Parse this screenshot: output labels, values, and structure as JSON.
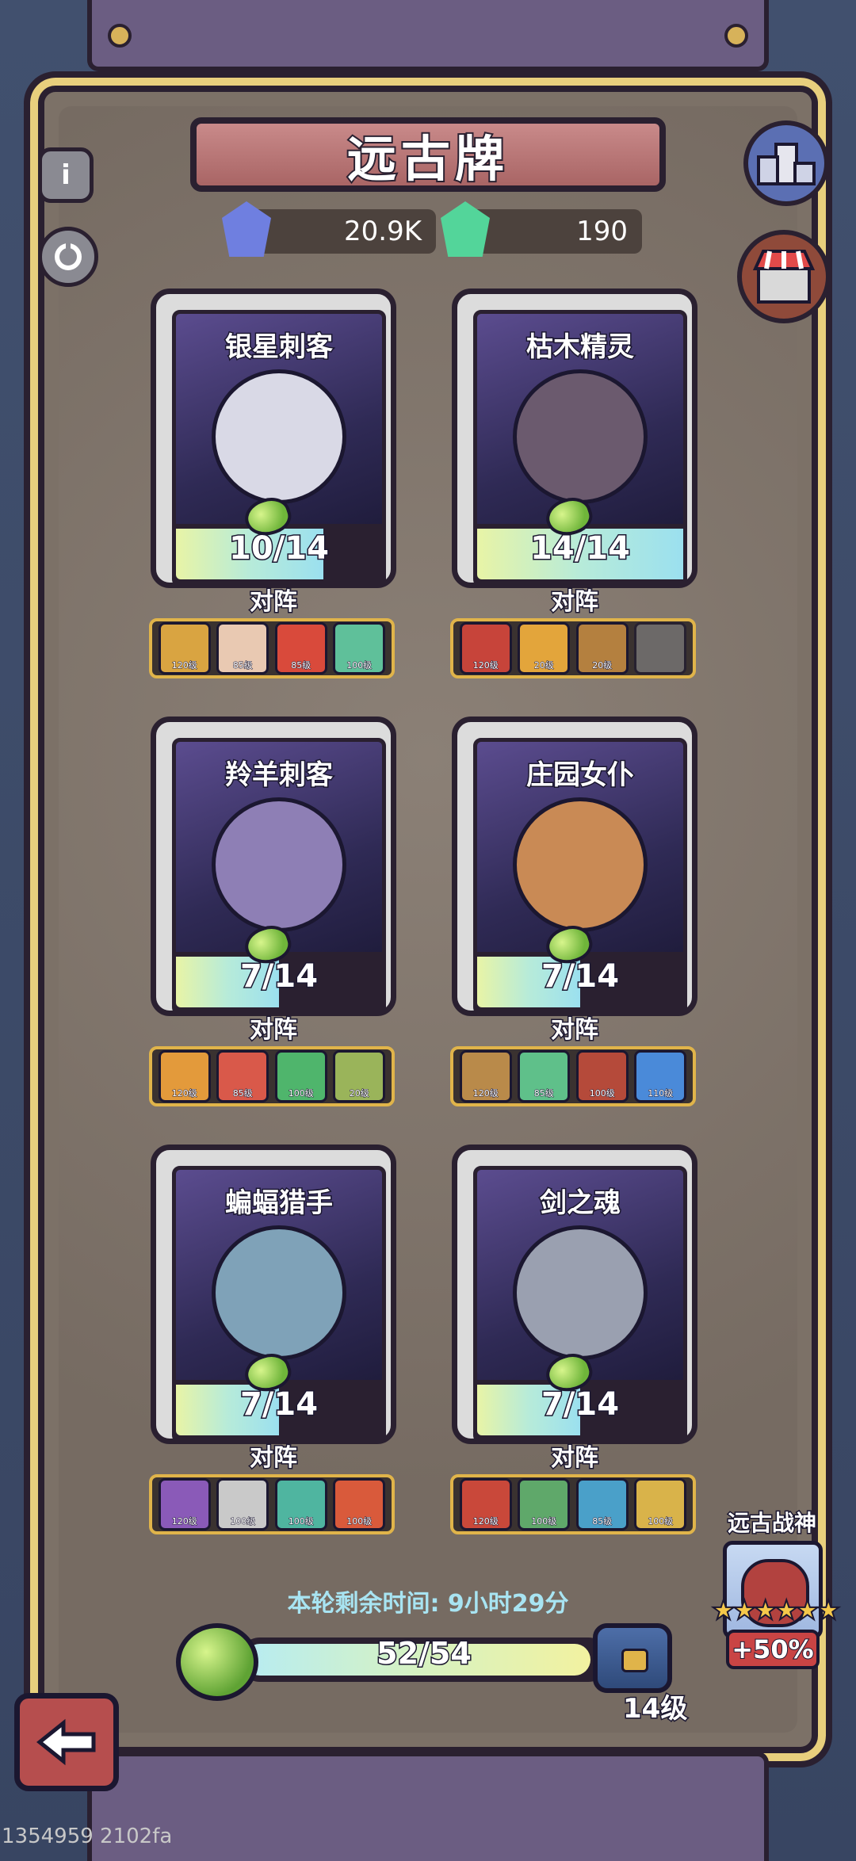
{
  "title": "远古牌",
  "currencies": [
    {
      "icon": "blue-crystal-icon",
      "value": "20.9K",
      "color": "#6f7fe0"
    },
    {
      "icon": "green-crystal-icon",
      "value": "190",
      "color": "#53d59a"
    }
  ],
  "side_buttons": {
    "info_icon": "i",
    "refresh_icon": "refresh-icon",
    "rank_icon": "podium-icon",
    "shop_icon": "shop-icon"
  },
  "cards": [
    {
      "name": "银星刺客",
      "progress_text": "10/14",
      "progress": 0.714,
      "portrait_color": "#d9d9e6",
      "lineup_label": "对阵",
      "lineup": [
        {
          "level": "120级",
          "color": "#d9a441"
        },
        {
          "level": "85级",
          "color": "#e9c9b2"
        },
        {
          "level": "85级",
          "color": "#d94a3b"
        },
        {
          "level": "100级",
          "color": "#5fc09a"
        }
      ]
    },
    {
      "name": "枯木精灵",
      "progress_text": "14/14",
      "progress": 1.0,
      "portrait_color": "#6b5a6e",
      "lineup_label": "对阵",
      "lineup": [
        {
          "level": "120级",
          "color": "#c7443a"
        },
        {
          "level": "20级",
          "color": "#e3a53b"
        },
        {
          "level": "20级",
          "color": "#b4803f"
        },
        {
          "level": "",
          "color": "#8e8e8e",
          "empty": true
        }
      ]
    },
    {
      "name": "羚羊刺客",
      "progress_text": "7/14",
      "progress": 0.5,
      "portrait_color": "#8e7fb5",
      "lineup_label": "对阵",
      "lineup": [
        {
          "level": "120级",
          "color": "#e39a3b"
        },
        {
          "level": "85级",
          "color": "#d9594a"
        },
        {
          "level": "100级",
          "color": "#4fb56c"
        },
        {
          "level": "20级",
          "color": "#9ab45a"
        }
      ]
    },
    {
      "name": "庄园女仆",
      "progress_text": "7/14",
      "progress": 0.5,
      "portrait_color": "#c98a55",
      "lineup_label": "对阵",
      "lineup": [
        {
          "level": "120级",
          "color": "#b98a4a"
        },
        {
          "level": "85级",
          "color": "#5fc08a"
        },
        {
          "level": "100级",
          "color": "#b54a3a"
        },
        {
          "level": "110级",
          "color": "#4a8ad9"
        }
      ]
    },
    {
      "name": "蝙蝠猎手",
      "progress_text": "7/14",
      "progress": 0.5,
      "portrait_color": "#7fa2b8",
      "lineup_label": "对阵",
      "lineup": [
        {
          "level": "120级",
          "color": "#8a5ab8"
        },
        {
          "level": "100级",
          "color": "#c9c9c9"
        },
        {
          "level": "100级",
          "color": "#4fb5a0"
        },
        {
          "level": "100级",
          "color": "#d95a3b"
        }
      ]
    },
    {
      "name": "剑之魂",
      "progress_text": "7/14",
      "progress": 0.5,
      "portrait_color": "#9aa0b0",
      "lineup_label": "对阵",
      "lineup": [
        {
          "level": "120级",
          "color": "#c9483a"
        },
        {
          "level": "100级",
          "color": "#5fa86a"
        },
        {
          "level": "85级",
          "color": "#4aa0c9"
        },
        {
          "level": "100级",
          "color": "#d9b34a"
        }
      ]
    }
  ],
  "timer": "本轮剩余时间: 9小时29分",
  "main_progress": {
    "text": "52/54",
    "value": 0.963
  },
  "chest_level": "14级",
  "boss": {
    "label": "远古战神",
    "stars": "★★★★★★",
    "bonus": "+50%"
  },
  "debug": "1354959 2102fa"
}
